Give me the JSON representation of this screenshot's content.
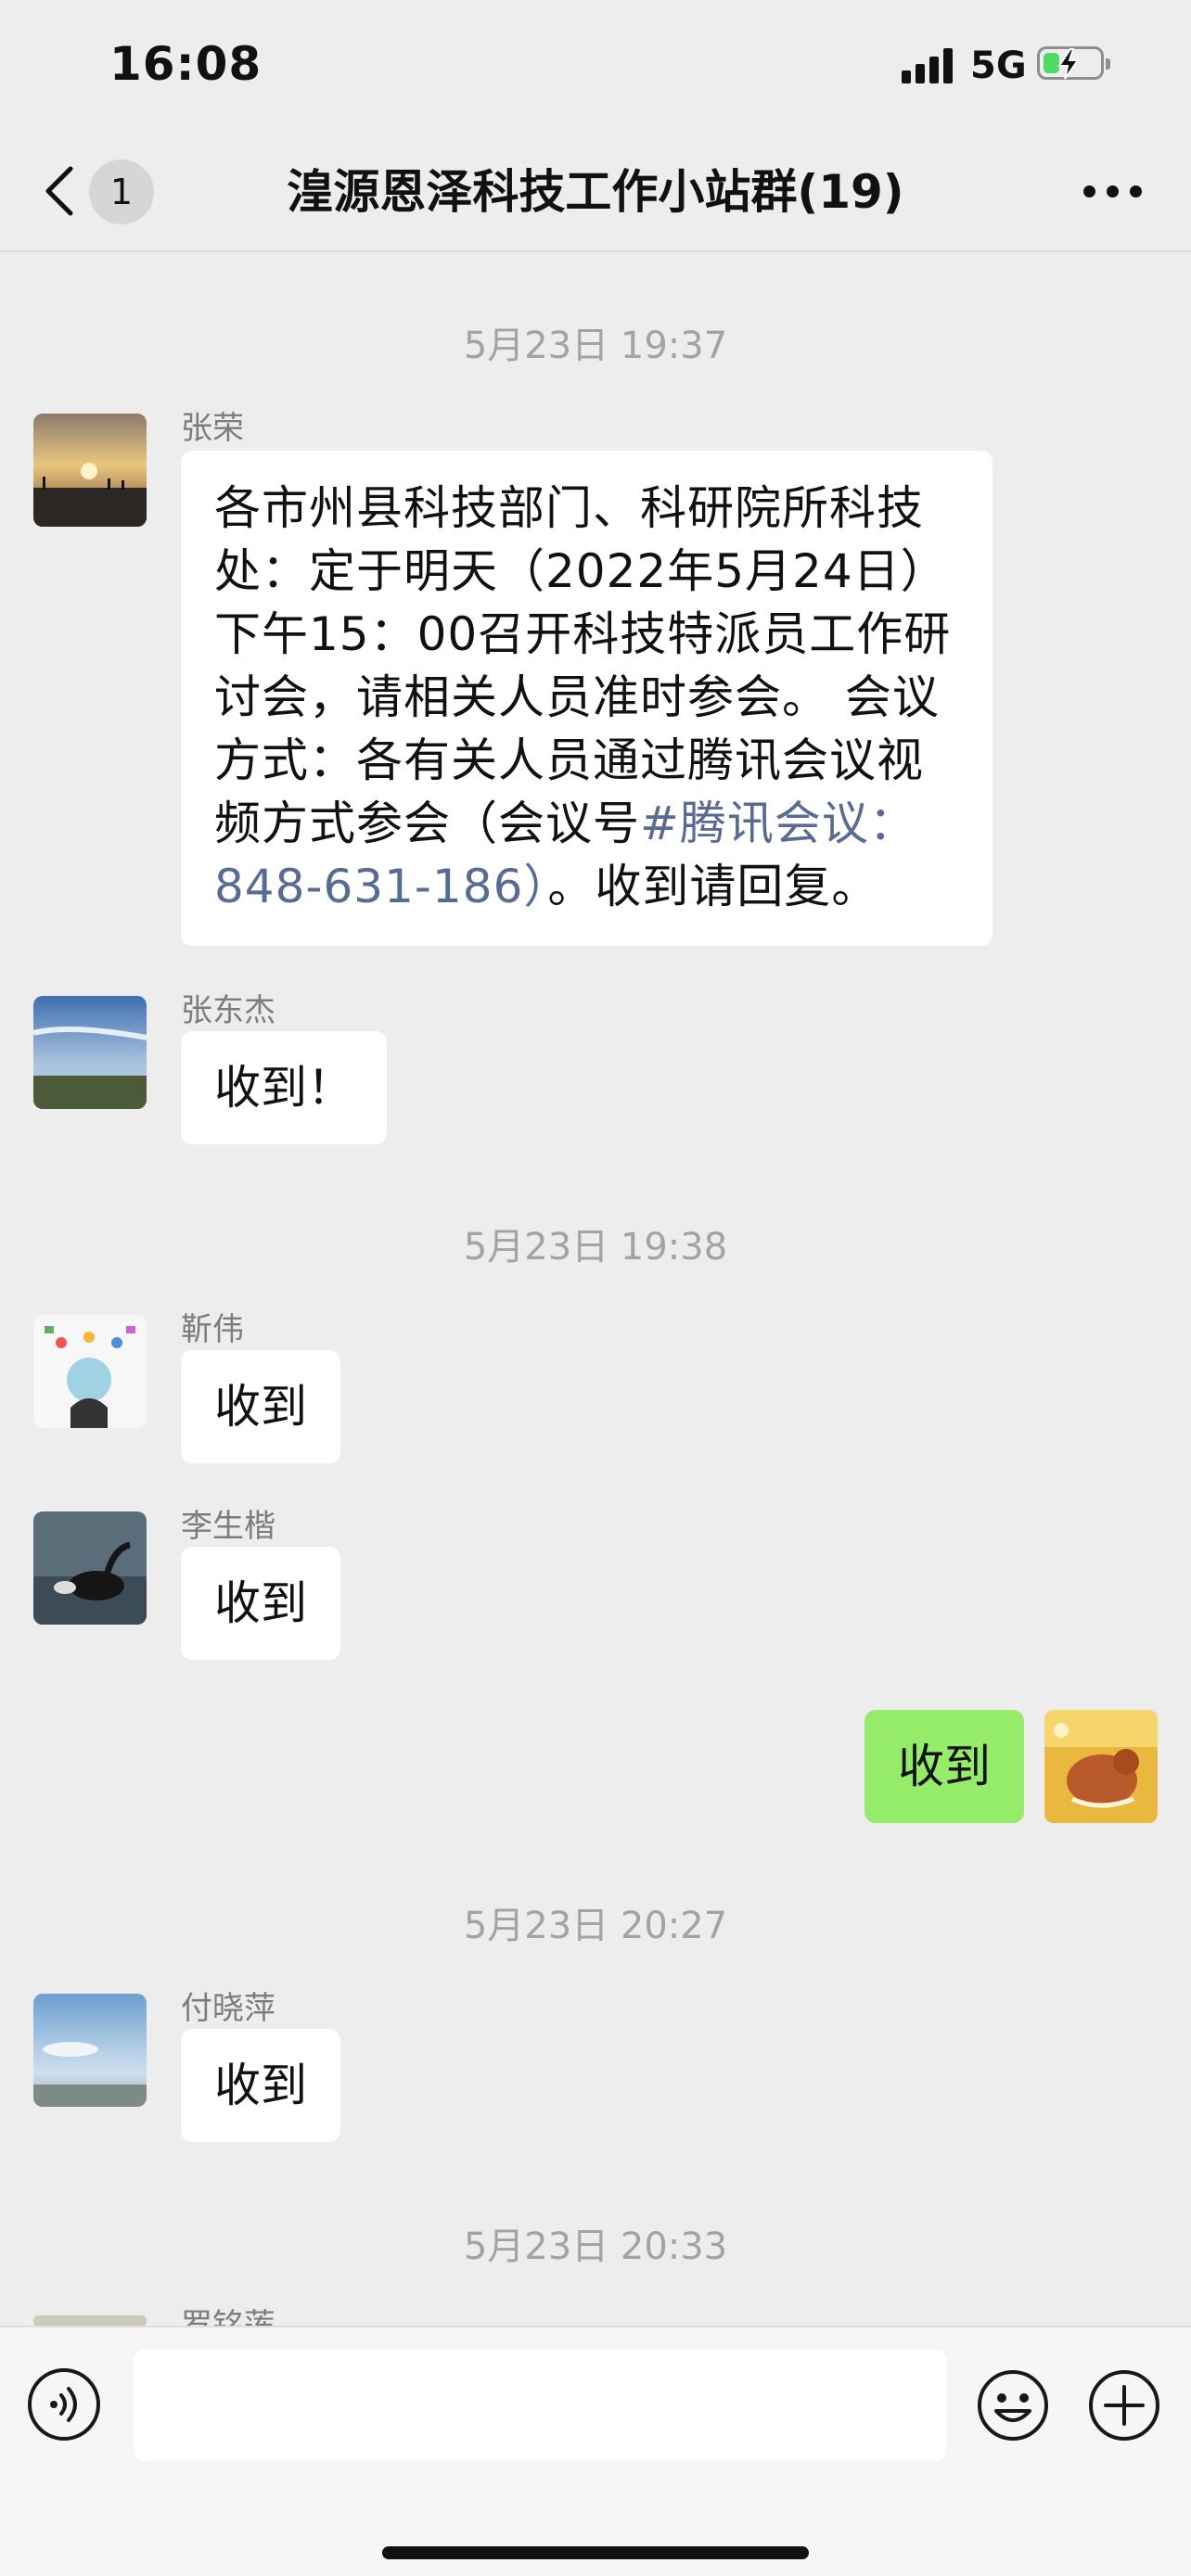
{
  "status_bar": {
    "time": "16:08",
    "network": "5G",
    "battery_level": 0.3,
    "charging": true
  },
  "nav": {
    "unread_count": "1",
    "title": "湟源恩泽科技工作小站群(19)",
    "back_icon": "chevron-left-icon",
    "more_icon": "ellipsis-icon"
  },
  "messages": {
    "time_1": "5月23日 19:37",
    "msg_1": {
      "sender": "张荣",
      "text_prefix": "各市州县科技部门、科研院所科技处：定于明天（2022年5月24日）下午15：00召开科技特派员工作研讨会，请相关人员准时参会。 会议方式：各有关人员通过腾讯会议视频方式参会（会议号",
      "link": "#腾讯会议：848-631-186）",
      "text_suffix": "。收到请回复。"
    },
    "msg_2": {
      "sender": "张东杰",
      "text": "收到！"
    },
    "time_2": "5月23日 19:38",
    "msg_3": {
      "sender": "靳伟",
      "text": "收到"
    },
    "msg_4": {
      "sender": "李生楷",
      "text": "收到"
    },
    "msg_5": {
      "text": "收到"
    },
    "time_3": "5月23日 20:27",
    "msg_6": {
      "sender": "付晓萍",
      "text": "收到"
    },
    "time_4": "5月23日 20:33",
    "msg_7": {
      "sender": "罗铭莲"
    }
  },
  "input_bar": {
    "placeholder": "",
    "value": "",
    "voice_icon": "voice-icon",
    "emoji_icon": "emoji-icon",
    "plus_icon": "plus-icon"
  },
  "colors": {
    "background": "#ededed",
    "self_bubble": "#95ec69",
    "other_bubble": "#ffffff",
    "link": "#576b95"
  }
}
